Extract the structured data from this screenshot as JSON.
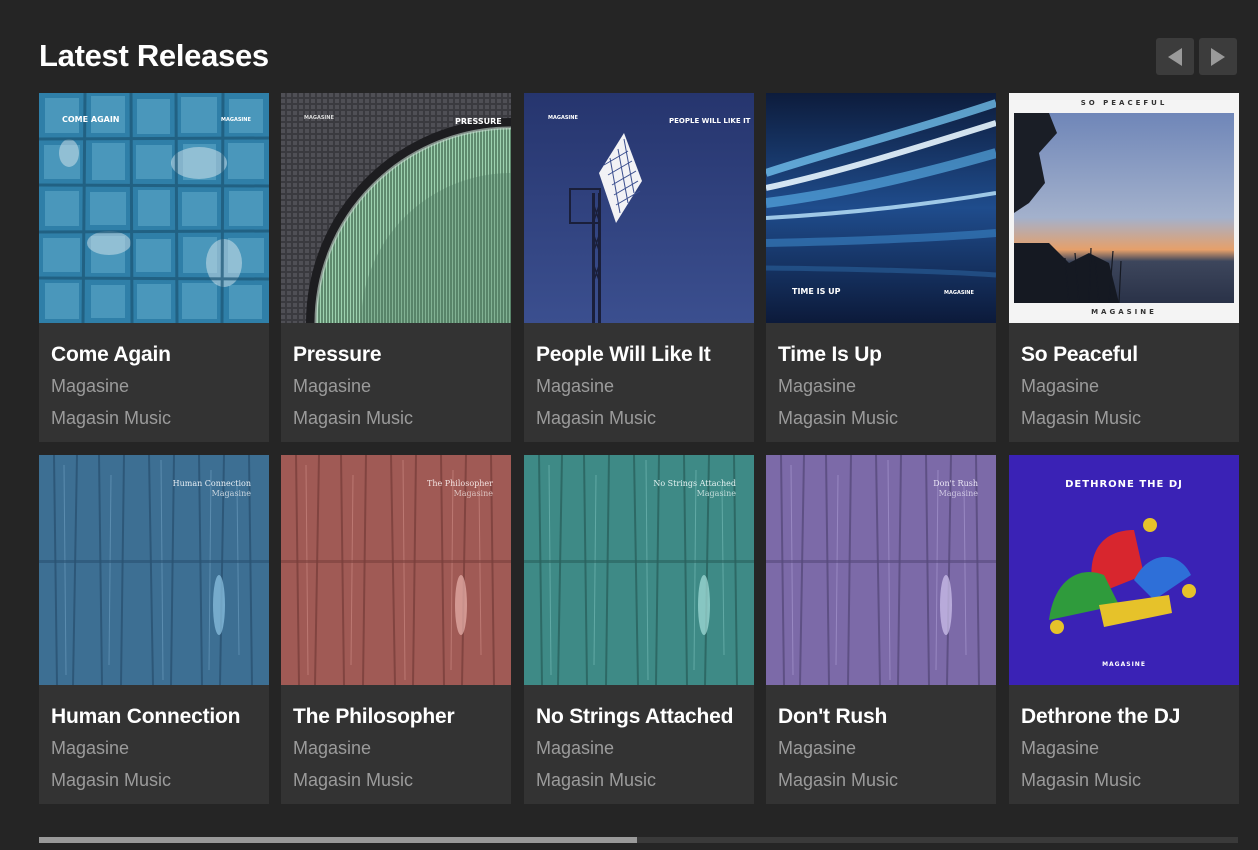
{
  "section": {
    "title": "Latest Releases"
  },
  "nav": {
    "prev_icon": "triangle-left-icon",
    "next_icon": "triangle-right-icon"
  },
  "releases": [
    {
      "title": "Come Again",
      "artist": "Magasine",
      "label": "Magasin Music",
      "cover": {
        "top_left": "COME AGAIN",
        "top_right": "MAGASINE",
        "bottom_left": "",
        "bottom_right": ""
      }
    },
    {
      "title": "Pressure",
      "artist": "Magasine",
      "label": "Magasin Music",
      "cover": {
        "top_left": "MAGASINE",
        "top_right": "PRESSURE",
        "bottom_left": "",
        "bottom_right": ""
      }
    },
    {
      "title": "People Will Like It",
      "artist": "Magasine",
      "label": "Magasin Music",
      "cover": {
        "top_left": "MAGASINE",
        "top_right": "PEOPLE WILL LIKE IT",
        "bottom_left": "",
        "bottom_right": ""
      }
    },
    {
      "title": "Time Is Up",
      "artist": "Magasine",
      "label": "Magasin Music",
      "cover": {
        "top_left": "",
        "top_right": "",
        "bottom_left": "TIME IS UP",
        "bottom_right": "MAGASINE"
      }
    },
    {
      "title": "So Peaceful",
      "artist": "Magasine",
      "label": "Magasin Music",
      "cover": {
        "top": "SO PEACEFUL",
        "bottom": "MAGASINE"
      }
    },
    {
      "title": "Human Connection",
      "artist": "Magasine",
      "label": "Magasin Music",
      "cover": {
        "line1": "Human Connection",
        "line2": "Magasine"
      }
    },
    {
      "title": "The Philosopher",
      "artist": "Magasine",
      "label": "Magasin Music",
      "cover": {
        "line1": "The Philosopher",
        "line2": "Magasine"
      }
    },
    {
      "title": "No Strings Attached",
      "artist": "Magasine",
      "label": "Magasin Music",
      "cover": {
        "line1": "No Strings Attached",
        "line2": "Magasine"
      }
    },
    {
      "title": "Don't Rush",
      "artist": "Magasine",
      "label": "Magasin Music",
      "cover": {
        "line1": "Don't Rush",
        "line2": "Magasine"
      }
    },
    {
      "title": "Dethrone the DJ",
      "artist": "Magasine",
      "label": "Magasin Music",
      "cover": {
        "top": "DETHRONE THE DJ",
        "bottom": "MAGASINE"
      }
    }
  ],
  "scroll": {
    "position_fraction": 0.5
  },
  "colors": {
    "background": "#252525",
    "card": "#333333",
    "title": "#ffffff",
    "meta": "#9b9b9b",
    "tile_blue": "#2f7fa8",
    "wood_blue": "#3d6f93",
    "wood_red": "#a05a55",
    "wood_teal": "#3e8a86",
    "wood_purple": "#7c6aa8",
    "jester_bg": "#3a22b5"
  }
}
